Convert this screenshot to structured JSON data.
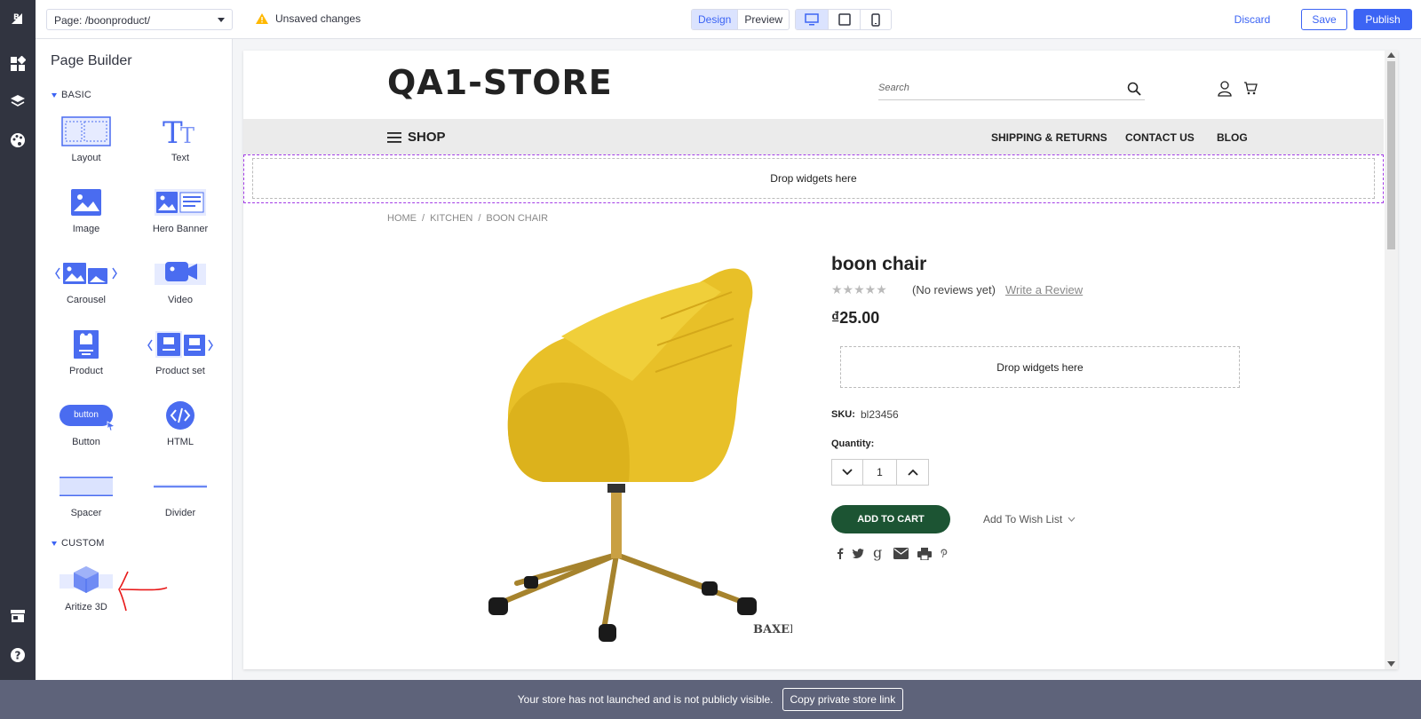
{
  "topbar": {
    "page_select": "Page: /boonproduct/",
    "unsaved": "Unsaved changes",
    "mode_tabs": [
      "Design",
      "Preview"
    ],
    "active_mode": "Design",
    "discard": "Discard",
    "save": "Save",
    "publish": "Publish",
    "accent": "#3c64f4"
  },
  "rail": {
    "icons": [
      "bigcommerce-logo-icon",
      "widgets-icon",
      "layers-icon",
      "palette-icon",
      "storefront-icon",
      "help-icon"
    ]
  },
  "sidebar": {
    "title": "Page Builder",
    "basic_label": "BASIC",
    "custom_label": "CUSTOM",
    "widgets": {
      "layout": "Layout",
      "text": "Text",
      "image": "Image",
      "hero_banner": "Hero Banner",
      "carousel": "Carousel",
      "video": "Video",
      "product": "Product",
      "product_set": "Product set",
      "button": "Button",
      "button_icon_text": "button",
      "html": "HTML",
      "spacer": "Spacer",
      "divider": "Divider",
      "aritize": "Aritize 3D"
    }
  },
  "store": {
    "logo": "QA1-STORE",
    "search_placeholder": "Search",
    "shop": "SHOP",
    "nav": [
      "SHIPPING & RETURNS",
      "CONTACT US",
      "BLOG"
    ],
    "drop_widgets": "Drop widgets here",
    "breadcrumb": [
      "HOME",
      "/",
      "KITCHEN",
      "/",
      "BOON CHAIR"
    ],
    "product": {
      "title": "boon chair",
      "stars": "★★★★★",
      "rating": 0,
      "reviews": "(No reviews yet)",
      "write_review": "Write a Review",
      "price": "₫25.00",
      "sku_label": "SKU:",
      "sku": "bl23456",
      "quantity_label": "Quantity:",
      "quantity": "1",
      "add_to_cart": "ADD TO CART",
      "wishlist": "Add To Wish List",
      "image_watermark": "BAXEK"
    },
    "social_icons": [
      "facebook-icon",
      "twitter-icon",
      "google-icon",
      "email-icon",
      "print-icon",
      "pinterest-icon"
    ]
  },
  "bottombar": {
    "message": "Your store has not launched and is not publicly visible.",
    "button": "Copy private store link"
  }
}
